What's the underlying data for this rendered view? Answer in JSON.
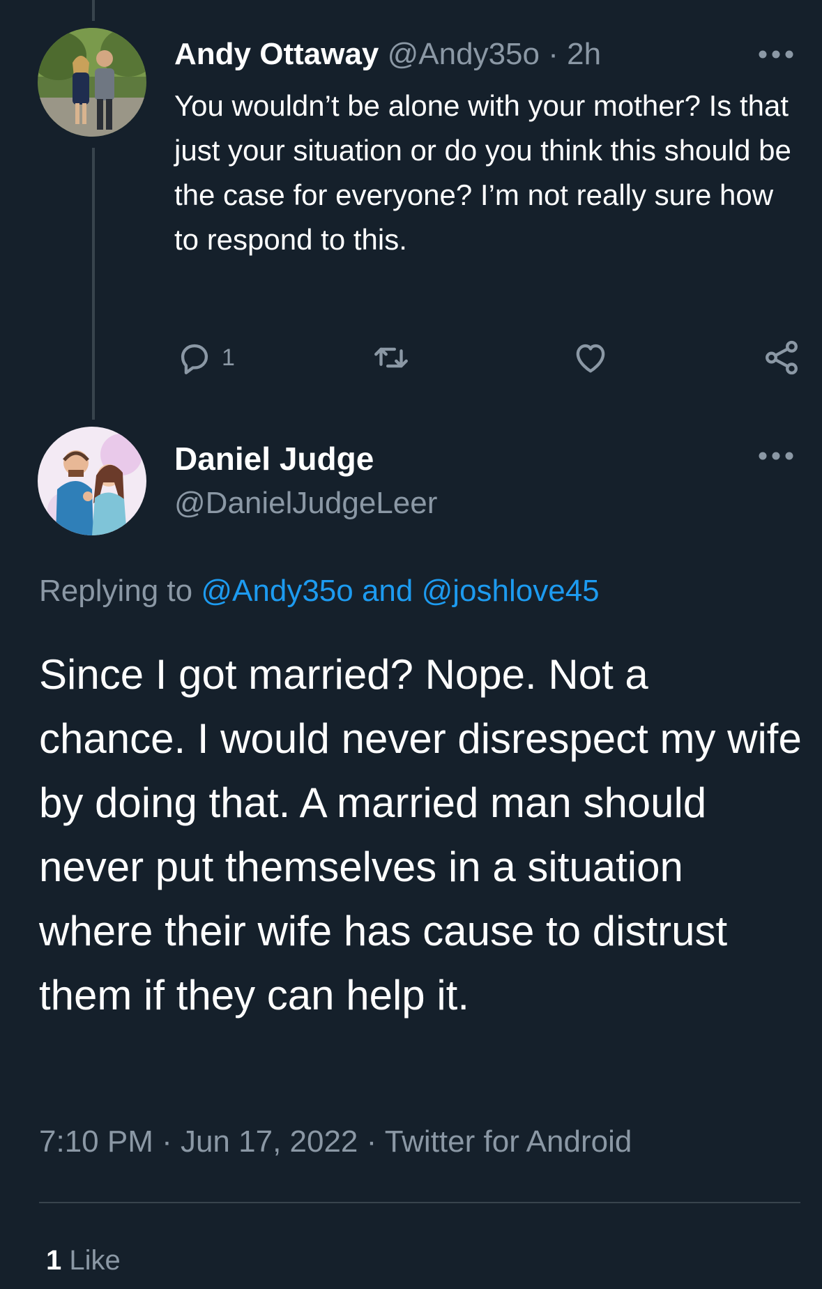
{
  "colors": {
    "background": "#15202b",
    "text": "#ffffff",
    "secondary_text": "#8b98a5",
    "link": "#1d9bf0",
    "divider": "#38444d"
  },
  "parent_tweet": {
    "author_name": "Andy Ottaway",
    "author_handle": "@Andy35o",
    "separator": " · ",
    "time": "2h",
    "body": "You wouldn’t be alone with your mother? Is that just your situation or do you think this should be the case for everyone? I’m not really sure how to respond to this.",
    "reply_count": "1",
    "icons": [
      "reply-icon",
      "retweet-icon",
      "like-icon",
      "share-icon",
      "more-icon"
    ]
  },
  "main_tweet": {
    "author_name": "Daniel Judge",
    "author_handle": "@DanielJudgeLeer",
    "replying_prefix": "Replying to ",
    "replying_mention_1": "@Andy35o",
    "replying_and": " and ",
    "replying_mention_2": "@joshlove45",
    "body": "Since I got married? Nope. Not a chance. I would never disrespect my wife by doing that. A married man should never put themselves in a situation where their wife has cause to distrust them if they can help it.",
    "timestamp": "7:10 PM · Jun 17, 2022 · Twitter for Android",
    "like_count": "1",
    "like_label": " Like"
  }
}
